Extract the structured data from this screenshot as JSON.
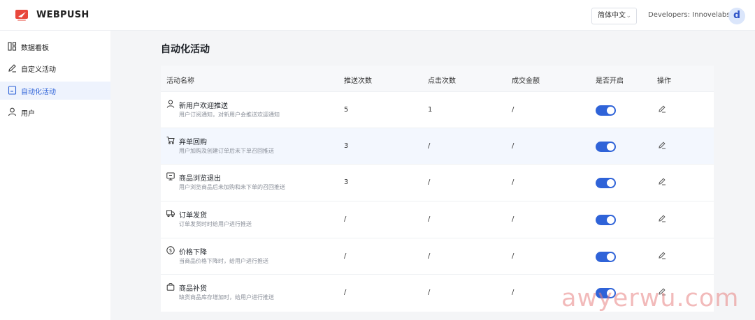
{
  "header": {
    "brand": "WEBPUSH",
    "language": "简体中文",
    "developer": "Developers: Innovelabs",
    "avatar_letter": "d"
  },
  "sidebar": {
    "items": [
      {
        "label": "数据看板",
        "icon": "dashboard-icon"
      },
      {
        "label": "自定义活动",
        "icon": "pencil-icon"
      },
      {
        "label": "自动化活动",
        "icon": "document-icon",
        "active": true
      },
      {
        "label": "用户",
        "icon": "user-icon"
      }
    ]
  },
  "page": {
    "title": "自动化活动"
  },
  "table": {
    "columns": [
      "活动名称",
      "推送次数",
      "点击次数",
      "成交金额",
      "是否开启",
      "操作"
    ],
    "rows": [
      {
        "icon": "user-icon",
        "name": "新用户欢迎推送",
        "desc": "用户订阅通知，对新用户会推送欢迎通知",
        "push": "5",
        "click": "1",
        "amount": "/",
        "enabled": true
      },
      {
        "icon": "cart-icon",
        "name": "弃单回购",
        "desc": "用户加购及创建订单后未下单召回推送",
        "push": "3",
        "click": "/",
        "amount": "/",
        "enabled": true
      },
      {
        "icon": "monitor-icon",
        "name": "商品浏览退出",
        "desc": "用户浏览商品后未加购和未下单的召回推送",
        "push": "3",
        "click": "/",
        "amount": "/",
        "enabled": true
      },
      {
        "icon": "truck-icon",
        "name": "订单发货",
        "desc": "订单发货时时给用户进行推送",
        "push": "/",
        "click": "/",
        "amount": "/",
        "enabled": true
      },
      {
        "icon": "dollar-icon",
        "name": "价格下降",
        "desc": "当商品价格下降时，给用户进行推送",
        "push": "/",
        "click": "/",
        "amount": "/",
        "enabled": true
      },
      {
        "icon": "bag-icon",
        "name": "商品补货",
        "desc": "缺货商品库存增加时，给用户进行推送",
        "push": "/",
        "click": "/",
        "amount": "/",
        "enabled": true
      }
    ]
  },
  "watermark": "awyerwu.com",
  "colors": {
    "accent": "#2f63d8",
    "brand": "#e8473c"
  }
}
